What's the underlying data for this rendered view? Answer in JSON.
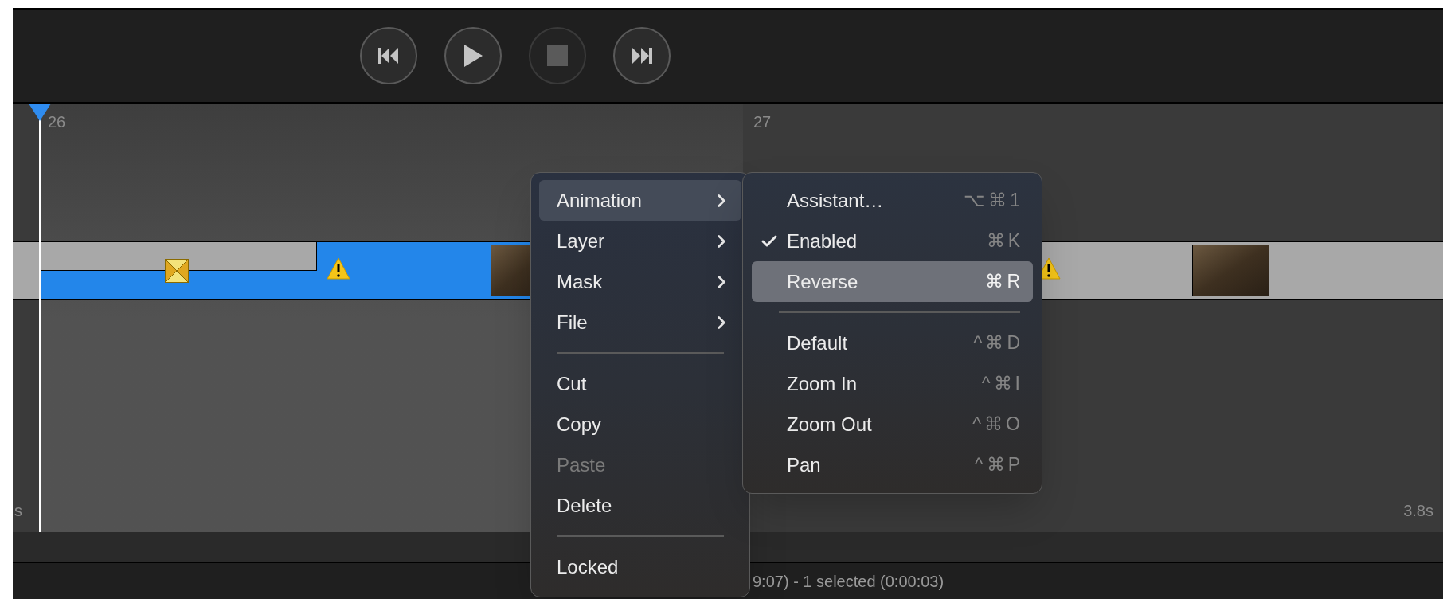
{
  "transport": [
    {
      "kind": "rewind",
      "disabled": false
    },
    {
      "kind": "play",
      "disabled": false
    },
    {
      "kind": "stop",
      "disabled": true
    },
    {
      "kind": "forward",
      "disabled": false
    }
  ],
  "ruler": {
    "labels": [
      "26",
      "27"
    ]
  },
  "timeline": {
    "start_label": "s",
    "end_label": "3.8s"
  },
  "status_bar": {
    "text": "9:07) - 1 selected (0:00:03)"
  },
  "context_menu": {
    "items": [
      {
        "kind": "submenu",
        "label": "Animation",
        "selected": true,
        "disabled": false
      },
      {
        "kind": "submenu",
        "label": "Layer",
        "selected": false,
        "disabled": false
      },
      {
        "kind": "submenu",
        "label": "Mask",
        "selected": false,
        "disabled": false
      },
      {
        "kind": "submenu",
        "label": "File",
        "selected": false,
        "disabled": false
      },
      {
        "kind": "separator"
      },
      {
        "kind": "action",
        "label": "Cut",
        "selected": false,
        "disabled": false
      },
      {
        "kind": "action",
        "label": "Copy",
        "selected": false,
        "disabled": false
      },
      {
        "kind": "action",
        "label": "Paste",
        "selected": false,
        "disabled": true
      },
      {
        "kind": "action",
        "label": "Delete",
        "selected": false,
        "disabled": false
      },
      {
        "kind": "separator"
      },
      {
        "kind": "action",
        "label": "Locked",
        "selected": false,
        "disabled": false
      }
    ]
  },
  "submenu": {
    "items": [
      {
        "kind": "action",
        "label": "Assistant…",
        "shortcut": "⌥⌘1",
        "checked": false,
        "selected": false
      },
      {
        "kind": "action",
        "label": "Enabled",
        "shortcut": "⌘K",
        "checked": true,
        "selected": false
      },
      {
        "kind": "action",
        "label": "Reverse",
        "shortcut": "⌘R",
        "checked": false,
        "selected": true
      },
      {
        "kind": "separator"
      },
      {
        "kind": "action",
        "label": "Default",
        "shortcut": "^⌘D",
        "checked": false,
        "selected": false
      },
      {
        "kind": "action",
        "label": "Zoom In",
        "shortcut": "^⌘I",
        "checked": false,
        "selected": false
      },
      {
        "kind": "action",
        "label": "Zoom Out",
        "shortcut": "^⌘O",
        "checked": false,
        "selected": false
      },
      {
        "kind": "action",
        "label": "Pan",
        "shortcut": "^⌘P",
        "checked": false,
        "selected": false
      }
    ]
  }
}
